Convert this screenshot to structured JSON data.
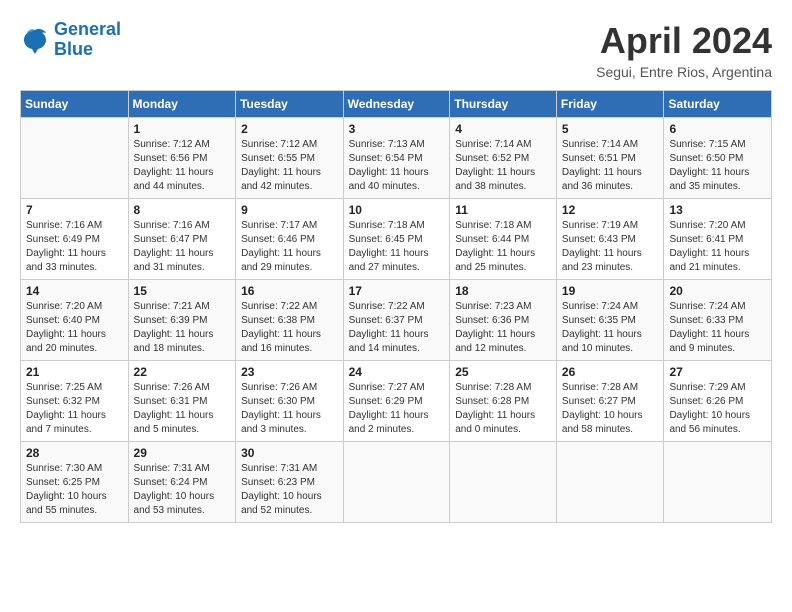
{
  "logo": {
    "line1": "General",
    "line2": "Blue"
  },
  "title": "April 2024",
  "subtitle": "Segui, Entre Rios, Argentina",
  "weekdays": [
    "Sunday",
    "Monday",
    "Tuesday",
    "Wednesday",
    "Thursday",
    "Friday",
    "Saturday"
  ],
  "weeks": [
    [
      {
        "day": "",
        "info": ""
      },
      {
        "day": "1",
        "info": "Sunrise: 7:12 AM\nSunset: 6:56 PM\nDaylight: 11 hours\nand 44 minutes."
      },
      {
        "day": "2",
        "info": "Sunrise: 7:12 AM\nSunset: 6:55 PM\nDaylight: 11 hours\nand 42 minutes."
      },
      {
        "day": "3",
        "info": "Sunrise: 7:13 AM\nSunset: 6:54 PM\nDaylight: 11 hours\nand 40 minutes."
      },
      {
        "day": "4",
        "info": "Sunrise: 7:14 AM\nSunset: 6:52 PM\nDaylight: 11 hours\nand 38 minutes."
      },
      {
        "day": "5",
        "info": "Sunrise: 7:14 AM\nSunset: 6:51 PM\nDaylight: 11 hours\nand 36 minutes."
      },
      {
        "day": "6",
        "info": "Sunrise: 7:15 AM\nSunset: 6:50 PM\nDaylight: 11 hours\nand 35 minutes."
      }
    ],
    [
      {
        "day": "7",
        "info": "Sunrise: 7:16 AM\nSunset: 6:49 PM\nDaylight: 11 hours\nand 33 minutes."
      },
      {
        "day": "8",
        "info": "Sunrise: 7:16 AM\nSunset: 6:47 PM\nDaylight: 11 hours\nand 31 minutes."
      },
      {
        "day": "9",
        "info": "Sunrise: 7:17 AM\nSunset: 6:46 PM\nDaylight: 11 hours\nand 29 minutes."
      },
      {
        "day": "10",
        "info": "Sunrise: 7:18 AM\nSunset: 6:45 PM\nDaylight: 11 hours\nand 27 minutes."
      },
      {
        "day": "11",
        "info": "Sunrise: 7:18 AM\nSunset: 6:44 PM\nDaylight: 11 hours\nand 25 minutes."
      },
      {
        "day": "12",
        "info": "Sunrise: 7:19 AM\nSunset: 6:43 PM\nDaylight: 11 hours\nand 23 minutes."
      },
      {
        "day": "13",
        "info": "Sunrise: 7:20 AM\nSunset: 6:41 PM\nDaylight: 11 hours\nand 21 minutes."
      }
    ],
    [
      {
        "day": "14",
        "info": "Sunrise: 7:20 AM\nSunset: 6:40 PM\nDaylight: 11 hours\nand 20 minutes."
      },
      {
        "day": "15",
        "info": "Sunrise: 7:21 AM\nSunset: 6:39 PM\nDaylight: 11 hours\nand 18 minutes."
      },
      {
        "day": "16",
        "info": "Sunrise: 7:22 AM\nSunset: 6:38 PM\nDaylight: 11 hours\nand 16 minutes."
      },
      {
        "day": "17",
        "info": "Sunrise: 7:22 AM\nSunset: 6:37 PM\nDaylight: 11 hours\nand 14 minutes."
      },
      {
        "day": "18",
        "info": "Sunrise: 7:23 AM\nSunset: 6:36 PM\nDaylight: 11 hours\nand 12 minutes."
      },
      {
        "day": "19",
        "info": "Sunrise: 7:24 AM\nSunset: 6:35 PM\nDaylight: 11 hours\nand 10 minutes."
      },
      {
        "day": "20",
        "info": "Sunrise: 7:24 AM\nSunset: 6:33 PM\nDaylight: 11 hours\nand 9 minutes."
      }
    ],
    [
      {
        "day": "21",
        "info": "Sunrise: 7:25 AM\nSunset: 6:32 PM\nDaylight: 11 hours\nand 7 minutes."
      },
      {
        "day": "22",
        "info": "Sunrise: 7:26 AM\nSunset: 6:31 PM\nDaylight: 11 hours\nand 5 minutes."
      },
      {
        "day": "23",
        "info": "Sunrise: 7:26 AM\nSunset: 6:30 PM\nDaylight: 11 hours\nand 3 minutes."
      },
      {
        "day": "24",
        "info": "Sunrise: 7:27 AM\nSunset: 6:29 PM\nDaylight: 11 hours\nand 2 minutes."
      },
      {
        "day": "25",
        "info": "Sunrise: 7:28 AM\nSunset: 6:28 PM\nDaylight: 11 hours\nand 0 minutes."
      },
      {
        "day": "26",
        "info": "Sunrise: 7:28 AM\nSunset: 6:27 PM\nDaylight: 10 hours\nand 58 minutes."
      },
      {
        "day": "27",
        "info": "Sunrise: 7:29 AM\nSunset: 6:26 PM\nDaylight: 10 hours\nand 56 minutes."
      }
    ],
    [
      {
        "day": "28",
        "info": "Sunrise: 7:30 AM\nSunset: 6:25 PM\nDaylight: 10 hours\nand 55 minutes."
      },
      {
        "day": "29",
        "info": "Sunrise: 7:31 AM\nSunset: 6:24 PM\nDaylight: 10 hours\nand 53 minutes."
      },
      {
        "day": "30",
        "info": "Sunrise: 7:31 AM\nSunset: 6:23 PM\nDaylight: 10 hours\nand 52 minutes."
      },
      {
        "day": "",
        "info": ""
      },
      {
        "day": "",
        "info": ""
      },
      {
        "day": "",
        "info": ""
      },
      {
        "day": "",
        "info": ""
      }
    ]
  ]
}
